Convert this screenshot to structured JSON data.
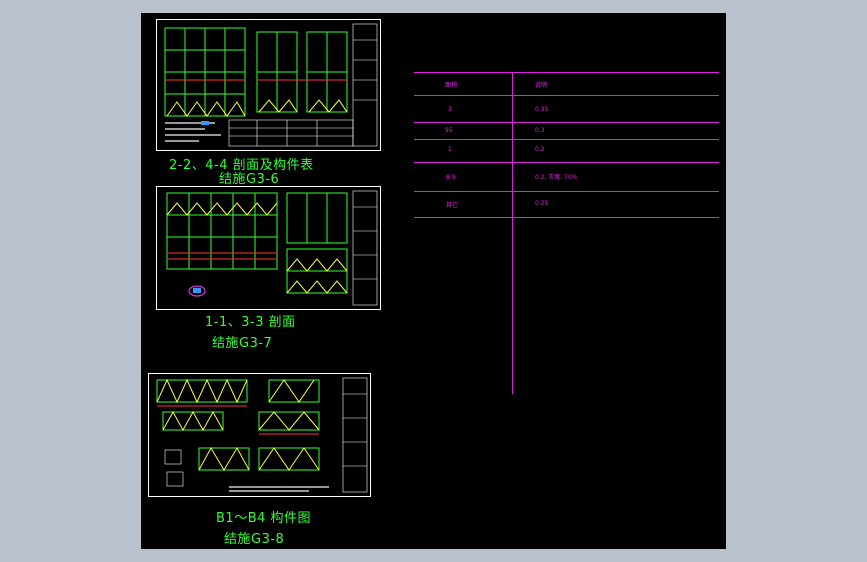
{
  "drawings": [
    {
      "caption_title": "2-2、4-4 剖面及构件表",
      "caption_code": "结施G3-6"
    },
    {
      "caption_title": "1-1、3-3 剖面",
      "caption_code": "结施G3-7"
    },
    {
      "caption_title": "B1～B4 构件图",
      "caption_code": "结施G3-8"
    }
  ],
  "table": {
    "header": [
      "面积",
      "说明"
    ],
    "rows": [
      [
        "3",
        "0.35"
      ],
      [
        "95",
        "0.3"
      ],
      [
        "1",
        "0.2"
      ],
      [
        "B.9",
        "0.2, 灰度, 70%"
      ],
      [
        "其它",
        "0.25"
      ]
    ]
  },
  "colors": {
    "background": "#000000",
    "frame": "#ffffff",
    "caption": "#33ff33",
    "structure_green": "#33ff33",
    "member_yellow": "#ffff33",
    "accent_red": "#ff3333",
    "table_magenta": "#e020e0"
  }
}
